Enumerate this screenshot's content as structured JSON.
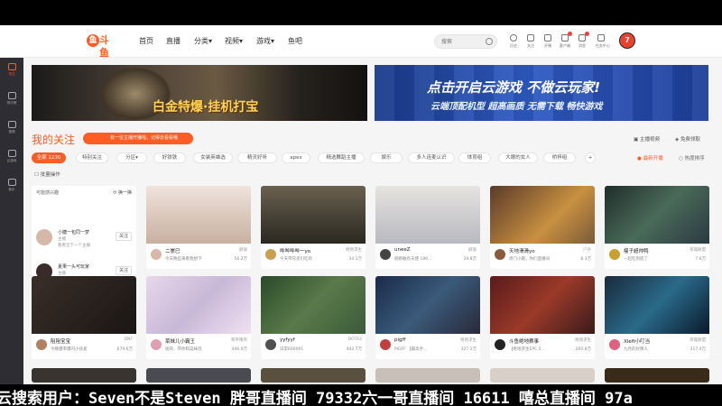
{
  "header": {
    "logo_text": "斗鱼",
    "nav": [
      "首页",
      "直播",
      "分类",
      "视频",
      "游戏",
      "鱼吧"
    ],
    "search_placeholder": "搜索",
    "icons": [
      {
        "label": "历史",
        "icon": "clock-icon"
      },
      {
        "label": "关注",
        "icon": "heart-icon"
      },
      {
        "label": "开播",
        "icon": "camera-icon"
      },
      {
        "label": "客户端",
        "icon": "monitor-icon"
      },
      {
        "label": "消息",
        "icon": "bell-icon"
      },
      {
        "label": "任务中心",
        "icon": "task-icon"
      }
    ]
  },
  "sidebar": {
    "items": [
      {
        "label": "关注",
        "icon": "heart-icon"
      },
      {
        "label": "排行榜",
        "icon": "rank-icon"
      },
      {
        "label": "视频",
        "icon": "video-icon"
      },
      {
        "label": "云游戏",
        "icon": "cloud-game-icon"
      },
      {
        "label": "鱼乐",
        "icon": "fish-icon"
      }
    ]
  },
  "banners": {
    "left_text": "白金特爆·挂机打宝",
    "right_title": "点击开启云游戏 不做云玩家!",
    "right_sub": "云端顶配机型 超高画质 无需下载 畅快游戏"
  },
  "follow": {
    "title": "我的关注",
    "tip": "有一位主播开播啦，记得去看看哦",
    "anchor_btn": "主播视频",
    "free_btn": "免费领取",
    "batch": "批量操作"
  },
  "filters": [
    "全部 1230",
    "特别关注",
    "分区",
    "好铁铁",
    "女装英雄选",
    "精灵好听",
    "apex",
    "精选舞蹈主播",
    "娱乐",
    "多人连麦认识",
    "体育组",
    "大眼的女人",
    "桥梓组"
  ],
  "sort": {
    "active": "最新开播",
    "other": "热度排序"
  },
  "recommend": {
    "header": "可能感兴趣",
    "refresh": "换一换",
    "items": [
      {
        "name": "小糖一包同一梦",
        "sub1": "主播",
        "sub2": "看看全下一个主播",
        "btn": "关注"
      },
      {
        "name": "夏果一头可玩家",
        "sub1": "主播",
        "sub2": "不会和别人的看啊",
        "btn": "关注"
      }
    ]
  },
  "cards": [
    {
      "name": "二崽巳",
      "cat": "颜值",
      "title": "今天晚些来看我想下",
      "hot": "56.2万",
      "color": "#e8d9d0"
    },
    {
      "name": "哔哔哔哔一yo",
      "cat": "绝地求生",
      "title": "今天带兄弟们吃鸡",
      "hot": "34.1万",
      "color": "#4a4538"
    },
    {
      "name": "uneeZ",
      "cat": "颜值",
      "title": "刚刚敢有天使 189...",
      "hot": "29.8万",
      "color": "#d8d6d2"
    },
    {
      "name": "天地滑滑yo",
      "cat": "户外",
      "title": "周门小跟，你们直播间",
      "hot": "8.3万",
      "color": "#8a6a3a"
    },
    {
      "name": "瘦子超帅鸭",
      "cat": "英雄联盟",
      "title": "一起吃到底了",
      "hot": "7.6万",
      "color": "#2e3e3a"
    },
    {
      "name": "阻阻宝宝",
      "cat": "DNF",
      "title": "今晚爆率爆闪小孩爱",
      "hot": "679.6万",
      "color": "#2a2420"
    },
    {
      "name": "菜妹儿小霸王",
      "cat": "和平精英",
      "title": "短哥，带你和菜妹玩",
      "hot": "446.0万",
      "color": "#d8c8d8"
    },
    {
      "name": "yyfyyf",
      "cat": "DOTA2",
      "title": "日常600001",
      "hot": "442.7万",
      "color": "#3a5a3a"
    },
    {
      "name": "pigff",
      "cat": "绝地求生",
      "title": "PIGFF 【最高手...",
      "hot": "327.1万",
      "color": "#2a3a5a"
    },
    {
      "name": "斗鱼绝地赛事",
      "cat": "绝地求生",
      "title": "【绝地求生EPC 5...",
      "hot": "260.8万",
      "color": "#5a2a2a"
    },
    {
      "name": "Xleft小叮当",
      "cat": "英雄联盟",
      "title": "九月的好像人",
      "hot": "317.4万",
      "color": "#1a2a3a"
    }
  ],
  "subtitle": "云搜索用户：Seven不是Steven 胖哥直播间 79332六一哥直播间 16611 嘻总直播间 97a"
}
